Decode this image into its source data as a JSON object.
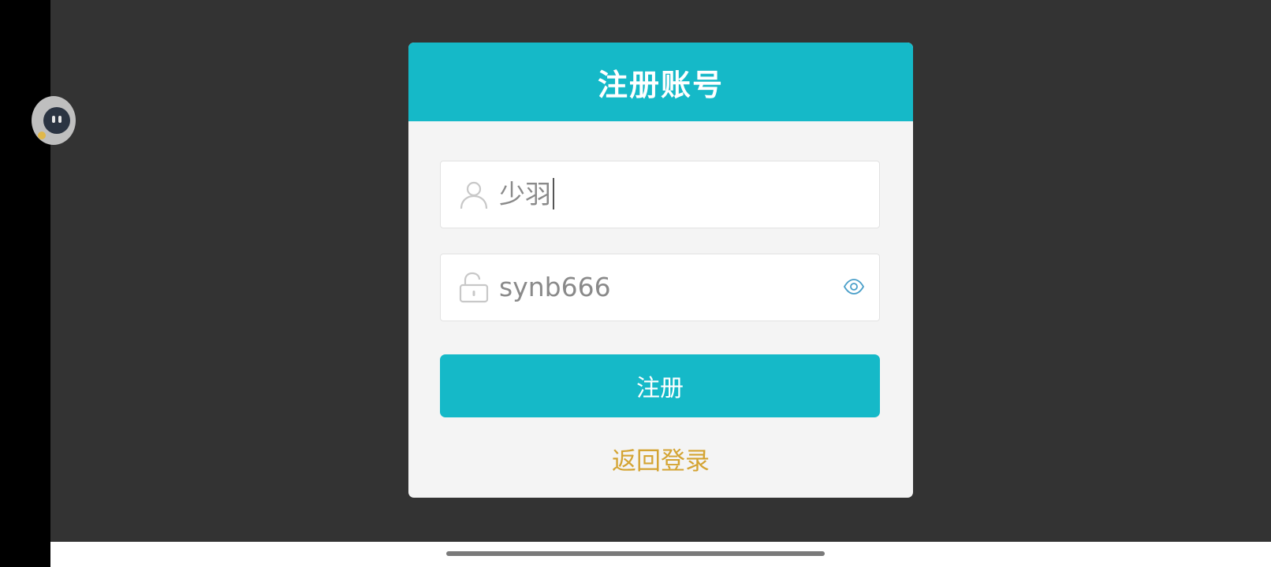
{
  "register_form": {
    "title": "注册账号",
    "username": {
      "value": "少羽",
      "icon": "user-icon"
    },
    "password": {
      "value": "synb666",
      "icon": "unlock-icon",
      "toggle_icon": "eye-icon"
    },
    "submit_label": "注册",
    "back_to_login_label": "返回登录"
  },
  "colors": {
    "accent": "#15b9c8",
    "link": "#d4a433",
    "backdrop": "#333333",
    "card": "#f4f4f4"
  }
}
